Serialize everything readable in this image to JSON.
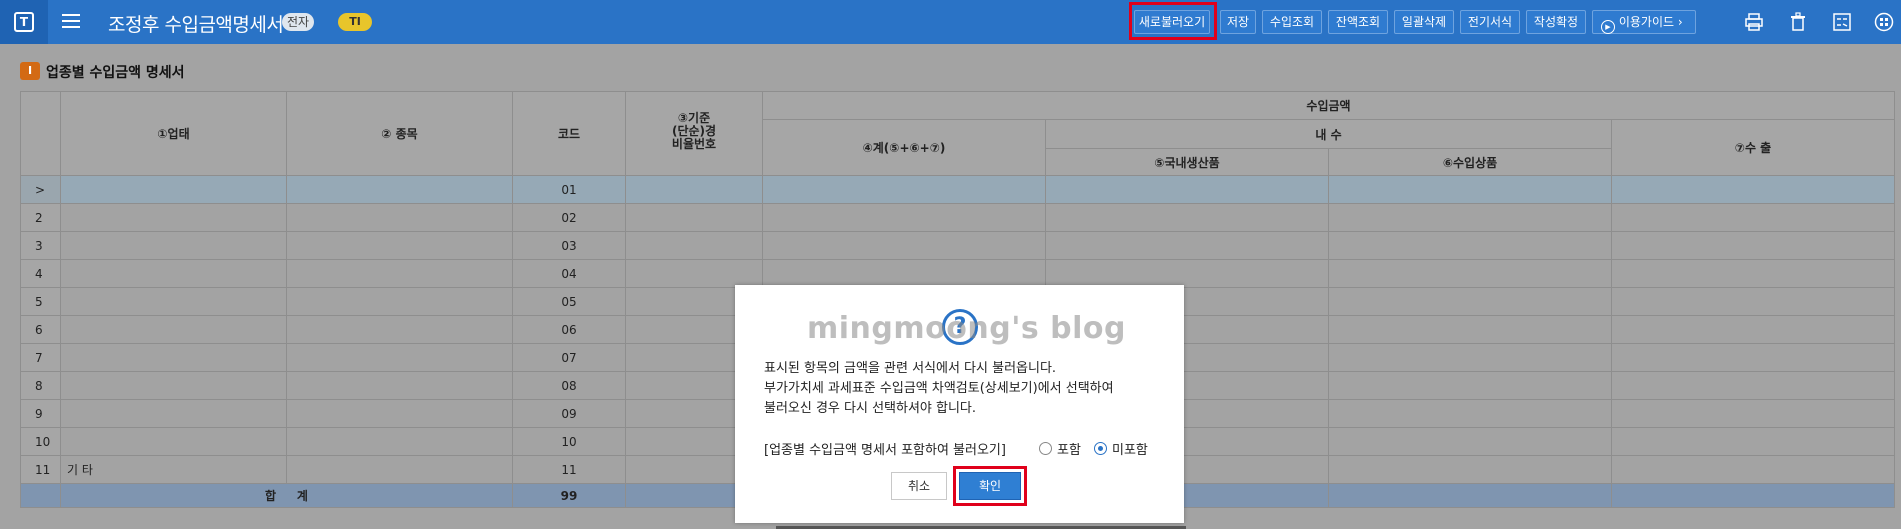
{
  "app": {
    "title": "조정후 수입금액명세서",
    "badge_elec": "전자",
    "badge_ti": "TI",
    "logo_letter": "T"
  },
  "toolbar": {
    "buttons": [
      "새로불러오기",
      "저장",
      "수입조회",
      "잔액조회",
      "일괄삭제",
      "전기서식",
      "작성확정",
      "이용가이드"
    ]
  },
  "section": {
    "num": "I",
    "title": "업종별 수입금액 명세서"
  },
  "table": {
    "headers": {
      "business_type": "①업태",
      "item": "② 종목",
      "code": "코드",
      "rate_no": "③기준\n(단순)경\n비율번호",
      "revenue": "수입금액",
      "domestic": "내 수",
      "total": "④계(⑤+⑥+⑦)",
      "domestic_goods": "⑤국내생산품",
      "imported_goods": "⑥수입상품",
      "export": "⑦수 출"
    },
    "rows": [
      {
        "num": ">",
        "business": "",
        "code": "01"
      },
      {
        "num": "2",
        "business": "",
        "code": "02"
      },
      {
        "num": "3",
        "business": "",
        "code": "03"
      },
      {
        "num": "4",
        "business": "",
        "code": "04"
      },
      {
        "num": "5",
        "business": "",
        "code": "05"
      },
      {
        "num": "6",
        "business": "",
        "code": "06"
      },
      {
        "num": "7",
        "business": "",
        "code": "07"
      },
      {
        "num": "8",
        "business": "",
        "code": "08"
      },
      {
        "num": "9",
        "business": "",
        "code": "09"
      },
      {
        "num": "10",
        "business": "",
        "code": "10"
      },
      {
        "num": "11",
        "business": "기  타",
        "code": "11"
      }
    ],
    "total_label": "합     계",
    "total_code": "99"
  },
  "dialog": {
    "icon": "?",
    "watermark": "mingmoong's blog",
    "message_lines": [
      "표시된 항목의 금액을 관련 서식에서 다시 불러옵니다.",
      "부가가치세 과세표준 수입금액 차액검토(상세보기)에서 선택하여",
      "불러오신 경우 다시 선택하셔야 합니다."
    ],
    "option_label": "[업종별 수입금액 명세서 포함하여 불러오기]",
    "option_include": "포함",
    "option_exclude": "미포함",
    "selected_option": "미포함",
    "cancel_label": "취소",
    "ok_label": "확인"
  },
  "colors": {
    "header_bg": "#2a73c6",
    "highlight_red": "#e0001b",
    "ok_button": "#2f7fd3"
  }
}
